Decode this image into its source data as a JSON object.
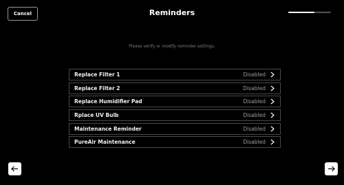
{
  "header": {
    "cancel_label": "Cancel",
    "title": "Reminders",
    "progress_fraction": 0.62
  },
  "instruction": "Please verify or modify reminder settings.",
  "reminders": [
    {
      "label": "Replace Filter 1",
      "status": "Disabled"
    },
    {
      "label": "Replace Filter 2",
      "status": "Disabled"
    },
    {
      "label": "Replace Humidifier Pad",
      "status": "Disabled"
    },
    {
      "label": "Rplace UV Bulb",
      "status": "Disabled"
    },
    {
      "label": "Maintenance Reminder",
      "status": "Disabled"
    },
    {
      "label": "PureAir Maintenance",
      "status": "Disabled"
    }
  ],
  "footer": {
    "back_icon": "arrow-left-icon",
    "next_icon": "arrow-right-icon"
  },
  "colors": {
    "background": "#000000",
    "row_border": "#4a4a4a",
    "status_text": "#9c9c9c"
  }
}
